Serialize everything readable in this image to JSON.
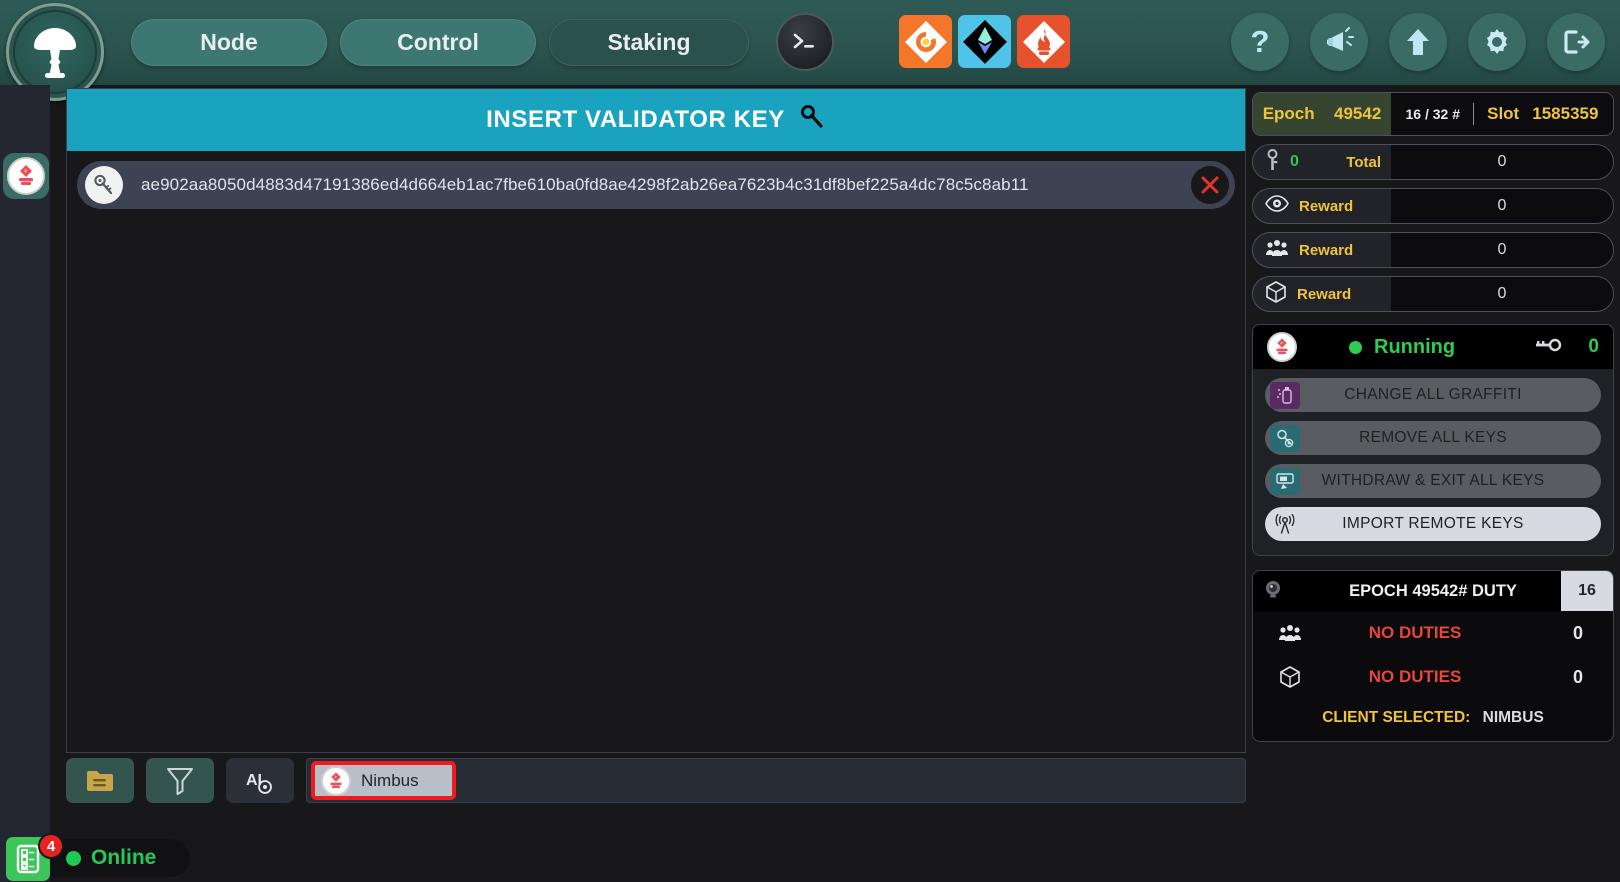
{
  "header": {
    "logo_icon": "mushroom-logo-icon",
    "tabs": [
      {
        "label": "Node",
        "active": false
      },
      {
        "label": "Control",
        "active": false
      },
      {
        "label": "Staking",
        "active": true
      }
    ],
    "terminal_icon": "terminal-icon",
    "services": [
      {
        "name": "grafana-icon"
      },
      {
        "name": "ethereum-icon"
      },
      {
        "name": "prometheus-icon"
      }
    ],
    "right_icons": [
      {
        "name": "help-icon",
        "glyph": "?"
      },
      {
        "name": "announcement-megaphone-icon"
      },
      {
        "name": "update-arrow-up-icon"
      },
      {
        "name": "settings-gear-icon"
      },
      {
        "name": "logout-icon"
      }
    ]
  },
  "left_rail": {
    "nimbus_button": "nimbus-client-icon"
  },
  "main": {
    "title": "INSERT VALIDATOR KEY",
    "title_icon": "key-icon",
    "key_row": {
      "avatar_icon": "key-avatar-icon",
      "pubkey": "ae902aa8050d4883d47191386ed4d664eb1ac7fbe610ba0fd8ae4298f2ab26ea7623b4c31df8bef225a4dc78c5c8ab11",
      "delete_icon": "close-x-icon"
    }
  },
  "toolbar": {
    "buttons": [
      {
        "name": "folder-open-icon"
      },
      {
        "name": "filter-funnel-icon"
      },
      {
        "name": "ai-text-icon"
      }
    ],
    "client_chip": {
      "label": "Nimbus",
      "icon": "nimbus-client-icon",
      "selected": true
    }
  },
  "statusbar": {
    "icon": "checklist-icon",
    "badge": "4",
    "label": "Online"
  },
  "sidebar": {
    "epoch": {
      "epoch_label": "Epoch",
      "epoch_value": "49542",
      "fraction": "16 / 32 #",
      "slot_label": "Slot",
      "slot_value": "1585359"
    },
    "stats": [
      {
        "icon": "key-small-icon",
        "count": "0",
        "label": "Total",
        "value": "0"
      },
      {
        "icon": "eye-attestation-icon",
        "label": "Reward",
        "value": "0"
      },
      {
        "icon": "sync-committee-icon",
        "label": "Reward",
        "value": "0"
      },
      {
        "icon": "block-proposal-icon",
        "label": "Reward",
        "value": "0"
      }
    ],
    "running": {
      "client_icon": "nimbus-client-icon",
      "status": "Running",
      "keys_icon": "key-count-icon",
      "keys_value": "0"
    },
    "actions": [
      {
        "name": "change-all-graffiti-button",
        "label": "CHANGE ALL GRAFFITI",
        "icon": "spray-can-icon",
        "style": "purple"
      },
      {
        "name": "remove-all-keys-button",
        "label": "REMOVE ALL KEYS",
        "icon": "key-remove-icon",
        "style": "teal"
      },
      {
        "name": "withdraw-exit-all-keys-button",
        "label": "WITHDRAW & EXIT ALL KEYS",
        "icon": "atm-withdraw-icon",
        "style": "teal"
      },
      {
        "name": "import-remote-keys-button",
        "label": "IMPORT REMOTE KEYS",
        "icon": "remote-signal-icon",
        "style": "light"
      }
    ],
    "duty": {
      "icon": "webcam-icon",
      "title": "EPOCH 49542# DUTY",
      "number": "16",
      "rows": [
        {
          "icon": "sync-committee-icon",
          "text": "NO DUTIES",
          "value": "0"
        },
        {
          "icon": "block-proposal-icon",
          "text": "NO DUTIES",
          "value": "0"
        }
      ],
      "client_selected_label": "CLIENT SELECTED:",
      "client_selected_value": "NIMBUS"
    }
  },
  "colors": {
    "header_teal": "#2c554f",
    "tab_teal": "#3c7771",
    "title_cyan": "#1aa3bf",
    "accent_yellow": "#f0c33c",
    "running_green": "#2ecc52",
    "danger_red": "#e8463c",
    "select_red": "#ee1c1c"
  }
}
